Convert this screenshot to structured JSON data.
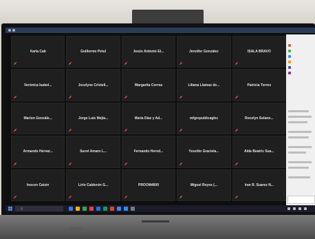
{
  "participants": [
    "Karla Cab",
    "Guillermo Petul",
    "Jesús Antonio Et...",
    "Jennifer González",
    "ISALA BRAVO",
    "Verónica Isabel...",
    "Jocelyne Cristell...",
    "Margarita Correa",
    "Liliana Llamas de...",
    "Patricia Torres",
    "Marlon Gonzále...",
    "Jorge Luis Mejía...",
    "María Díaz y Ad...",
    "mfgrepublicaglez",
    "Rocelyn Solano...",
    "Armando Hervar...",
    "Sucel Amaro L...",
    "Fernando Hernd...",
    "Yessitio Graciela...",
    "Alda Beatriz Sua...",
    "Inocen Catzin",
    "Lirio Calderón G...",
    "PROOM4600",
    "Miguel Reyes (...",
    "Iran R. Suarez N..."
  ],
  "taskbar": {
    "search_placeholder": "Q"
  },
  "colors": {
    "tile_bg": "#1f1f1f",
    "muted_mic": "#d9534f"
  }
}
